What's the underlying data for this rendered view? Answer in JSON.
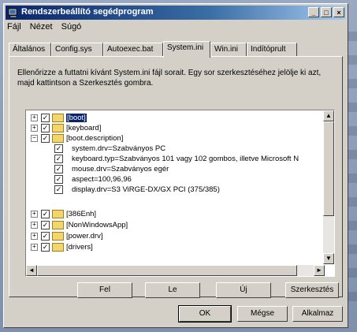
{
  "window": {
    "title": "Rendszerbeállító segédprogram",
    "controls": [
      "_",
      "□",
      "×"
    ]
  },
  "menu": [
    "Fájl",
    "Nézet",
    "Súgó"
  ],
  "tabs": [
    "Általános",
    "Config.sys",
    "Autoexec.bat",
    "System.ini",
    "Win.ini",
    "Indítóprult"
  ],
  "active_tab": "System.ini",
  "instructions": "Ellenőrizze a futtatni kívánt System.ini fájl sorait. Egy sor szerkesztéséhez jelölje ki azt, majd kattintson a Szerkesztés gombra.",
  "tree": [
    {
      "expander": "+",
      "check": "✓",
      "folder": true,
      "label": "[boot]",
      "selected": true
    },
    {
      "expander": "+",
      "check": "✓",
      "folder": true,
      "label": "[keyboard]"
    },
    {
      "expander": "−",
      "check": "✓",
      "folder": true,
      "label": "[boot.description]"
    },
    {
      "check": "✓",
      "label": "system.drv=Szabványos PC"
    },
    {
      "check": "✓",
      "label": "keyboard.typ=Szabványos 101 vagy 102 gombos, illetve Microsoft N"
    },
    {
      "check": "✓",
      "label": "mouse.drv=Szabványos egér"
    },
    {
      "check": "✓",
      "label": "aspect=100,96,96"
    },
    {
      "check": "✓",
      "label": "display.drv=S3 ViRGE-DX/GX PCI (375/385)"
    },
    {
      "expander": "+",
      "check": "✓",
      "folder": true,
      "label": "[386Enh]"
    },
    {
      "expander": "+",
      "check": "✓",
      "folder": true,
      "label": "[NonWindowsApp]"
    },
    {
      "expander": "+",
      "check": "✓",
      "folder": true,
      "label": "[power.drv]"
    },
    {
      "expander": "+",
      "check": "✓",
      "folder": true,
      "label": "[drivers]"
    }
  ],
  "scroll_arrows": {
    "up": "▲",
    "down": "▼",
    "left": "◄",
    "right": "►"
  },
  "panel_buttons": [
    "Fel",
    "Le",
    "Új",
    "Szerkesztés"
  ],
  "dialog_buttons": [
    "OK",
    "Mégse",
    "Alkalmaz"
  ]
}
